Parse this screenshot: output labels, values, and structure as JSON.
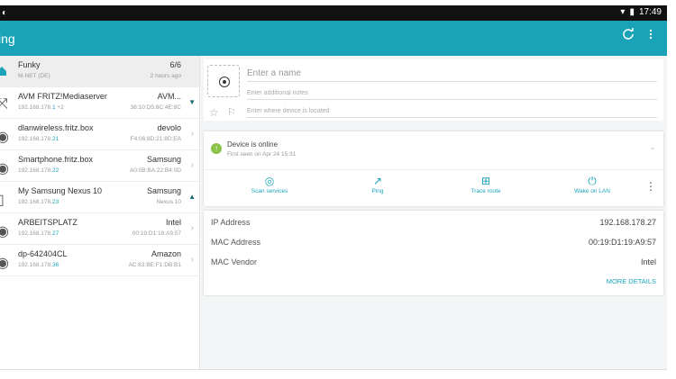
{
  "status": {
    "time": "17:49"
  },
  "appbar": {
    "title": "ing"
  },
  "devices": [
    {
      "name": "Funky",
      "sub_prefix": "M-NET (DE)",
      "sub_hi": "",
      "right": "6/6",
      "right_sub": "2 hours ago",
      "icon": "home-icon"
    },
    {
      "name": "AVM FRITZ!Mediaserver",
      "sub_prefix": "192.168.178.",
      "sub_hi": "1",
      "sub_suffix": " +2",
      "right": "AVM...",
      "right_sub": "38:10:D5:8C:4E:8C",
      "icon": "share-icon"
    },
    {
      "name": "dlanwireless.fritz.box",
      "sub_prefix": "192.168.178.",
      "sub_hi": "21",
      "right": "devolo",
      "right_sub": "F4:06:8D:21:8D:EA",
      "icon": "dot-icon"
    },
    {
      "name": "Smartphone.fritz.box",
      "sub_prefix": "192.168.178.",
      "sub_hi": "22",
      "right": "Samsung",
      "right_sub": "A0:0B:BA:22:B4:0D",
      "icon": "dot-icon"
    },
    {
      "name": "My Samsung Nexus 10",
      "sub_prefix": "192.168.178.",
      "sub_hi": "23",
      "right": "Samsung",
      "right_sub": "Nexus 10",
      "icon": "tablet-icon"
    },
    {
      "name": "ARBEITSPLATZ",
      "sub_prefix": "192.168.178.",
      "sub_hi": "27",
      "right": "Intel",
      "right_sub": "00:19:D1:19:A9:57",
      "icon": "dot-icon"
    },
    {
      "name": "dp-642404CL",
      "sub_prefix": "192.168.178.",
      "sub_hi": "36",
      "right": "Amazon",
      "right_sub": "AC:63:BE:F1:DB:B1",
      "icon": "dot-icon"
    }
  ],
  "detail": {
    "name_placeholder": "Enter a name",
    "notes_placeholder": "Enter additional notes",
    "location_placeholder": "Enter where device is located",
    "online_title": "Device is online",
    "first_seen": "First seen on Apr 24 15:31",
    "actions": [
      "Scan services",
      "Ping",
      "Trace route",
      "Wake on LAN"
    ],
    "ip_label": "IP Address",
    "ip_value": "192.168.178.27",
    "mac_label": "MAC Address",
    "mac_value": "00:19:D1:19:A9:57",
    "vendor_label": "MAC Vendor",
    "vendor_value": "Intel",
    "more_details": "MORE DETAILS"
  },
  "colors": {
    "accent": "#1aa3b8",
    "status_bar": "#111111",
    "online": "#8bc34a"
  }
}
